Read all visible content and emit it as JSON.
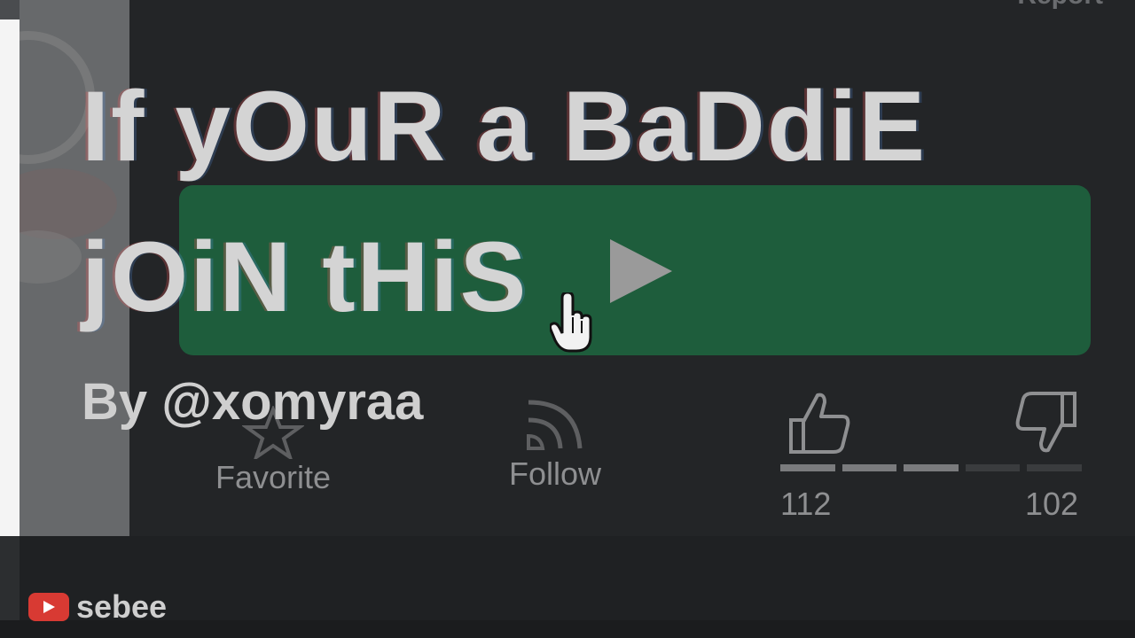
{
  "header": {
    "report_label": "Report"
  },
  "game": {
    "title": "If yOuR a BaDdiE jOiN tHiS",
    "byline": "By @xomyraa"
  },
  "actions": {
    "favorite_label": "Favorite",
    "follow_label": "Follow"
  },
  "votes": {
    "up_count": "112",
    "down_count": "102",
    "up_fraction": 0.52
  },
  "watermark": {
    "channel": "sebee"
  },
  "colors": {
    "background": "#232527",
    "play_button": "#1e5d3c",
    "title_text": "#d4d4d4",
    "muted_text": "#8e8f91",
    "youtube_red": "#d83a33"
  }
}
